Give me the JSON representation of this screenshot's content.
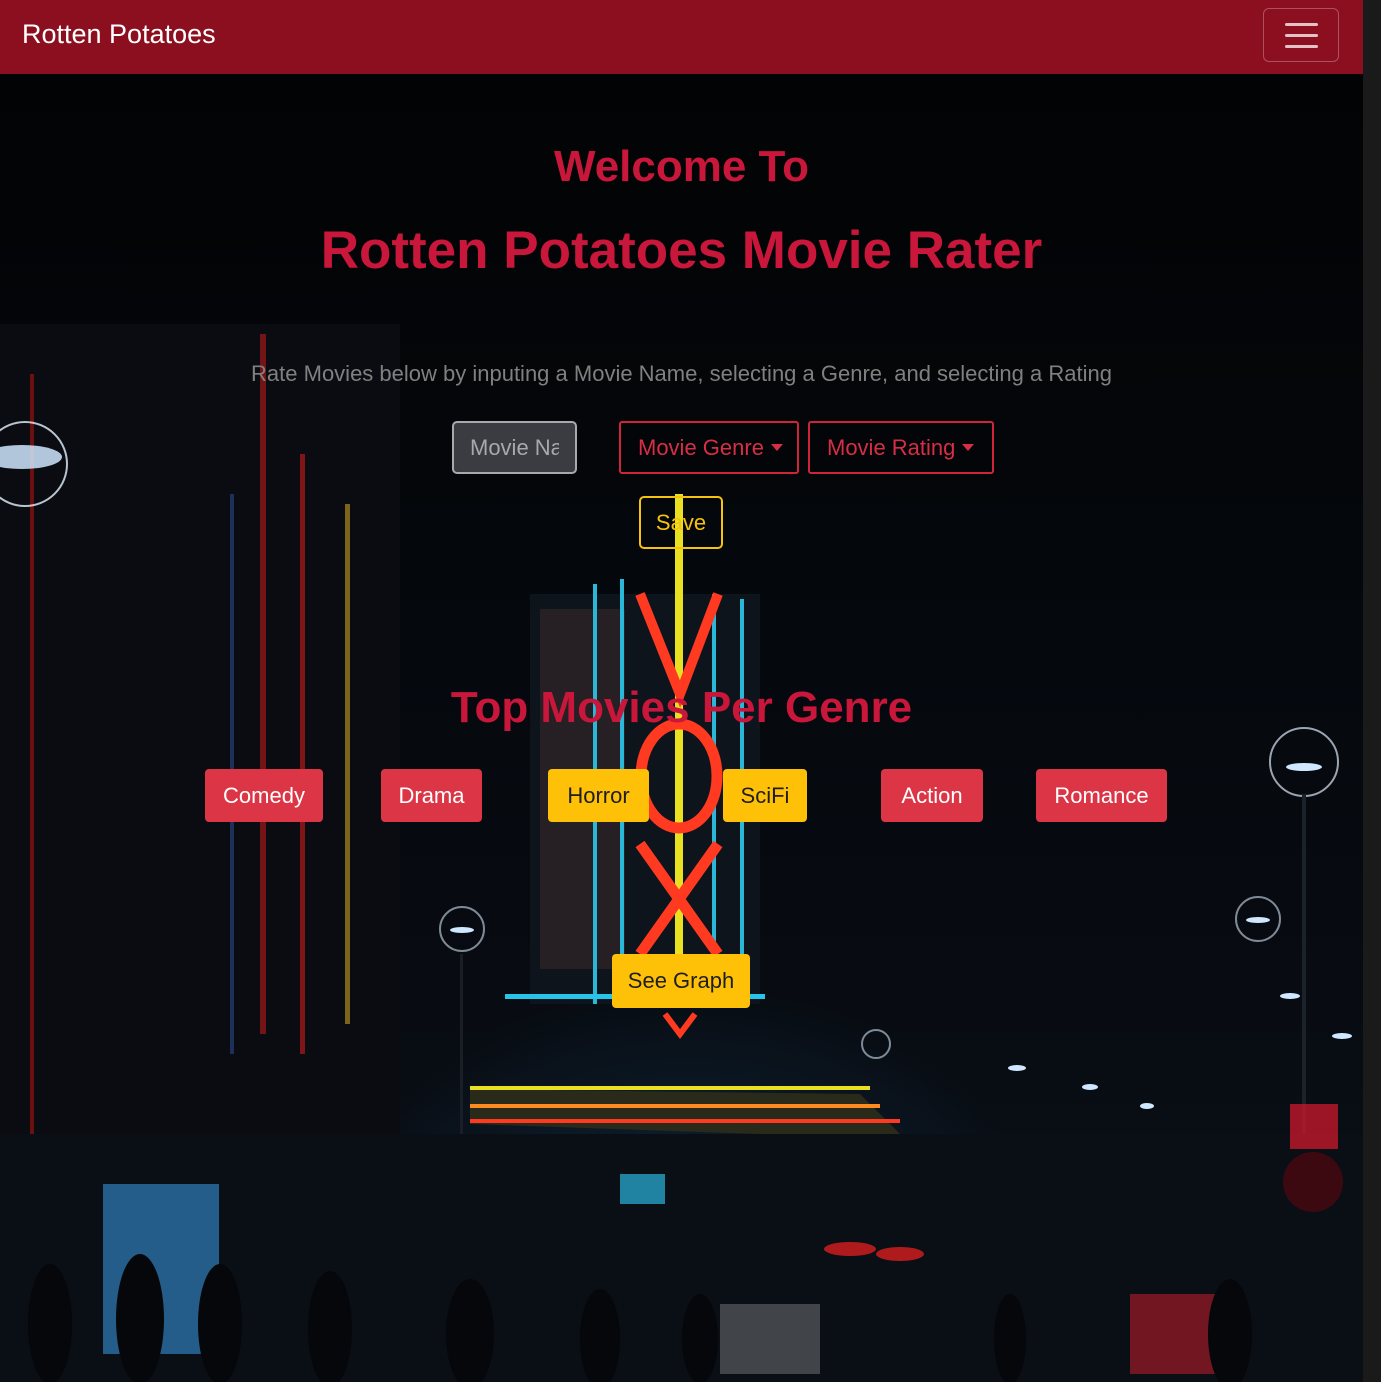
{
  "navbar": {
    "brand": "Rotten Potatoes",
    "menu_icon": "hamburger-menu-icon",
    "background_color": "#8c0f1f"
  },
  "hero": {
    "welcome": "Welcome To",
    "title": "Rotten Potatoes Movie Rater",
    "accent_color": "#c9163b"
  },
  "rating_form": {
    "instructions": "Rate Movies below by inputing a Movie Name, selecting a Genre, and selecting a Rating",
    "movie_name_placeholder": "Movie Name",
    "genre_dropdown": "Movie Genre",
    "rating_dropdown": "Movie Rating",
    "save_label": "Save"
  },
  "top_movies": {
    "heading": "Top Movies Per Genre",
    "genres": [
      {
        "label": "Comedy",
        "color": "#dc3545"
      },
      {
        "label": "Drama",
        "color": "#dc3545"
      },
      {
        "label": "Horror",
        "color": "#ffc107"
      },
      {
        "label": "SciFi",
        "color": "#ffc107"
      },
      {
        "label": "Action",
        "color": "#dc3545"
      },
      {
        "label": "Romance",
        "color": "#dc3545"
      }
    ],
    "see_graph_label": "See Graph"
  },
  "background": {
    "sign_letters": [
      "V",
      "O",
      "X"
    ]
  }
}
